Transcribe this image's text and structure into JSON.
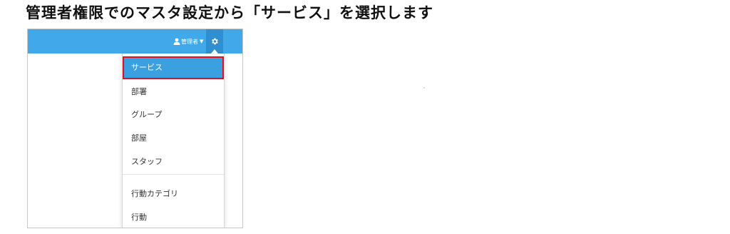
{
  "caption": {
    "text": "管理者権限でのマスタ設定から「サービス」を選択します"
  },
  "topbar": {
    "user_label": "管理者",
    "user_icon": "user-icon",
    "settings_icon": "gear-icon",
    "bar_color": "#41a9e9"
  },
  "dropdown": {
    "items": [
      {
        "label": "サービス",
        "active": true
      },
      {
        "label": "部署",
        "active": false
      },
      {
        "label": "グループ",
        "active": false
      },
      {
        "label": "部屋",
        "active": false
      },
      {
        "label": "スタッフ",
        "active": false
      },
      {
        "label": "行動カテゴリ",
        "active": false
      },
      {
        "label": "行動",
        "active": false
      }
    ],
    "highlight_color": "#3aa0e0",
    "highlight_border": "#e01020"
  }
}
